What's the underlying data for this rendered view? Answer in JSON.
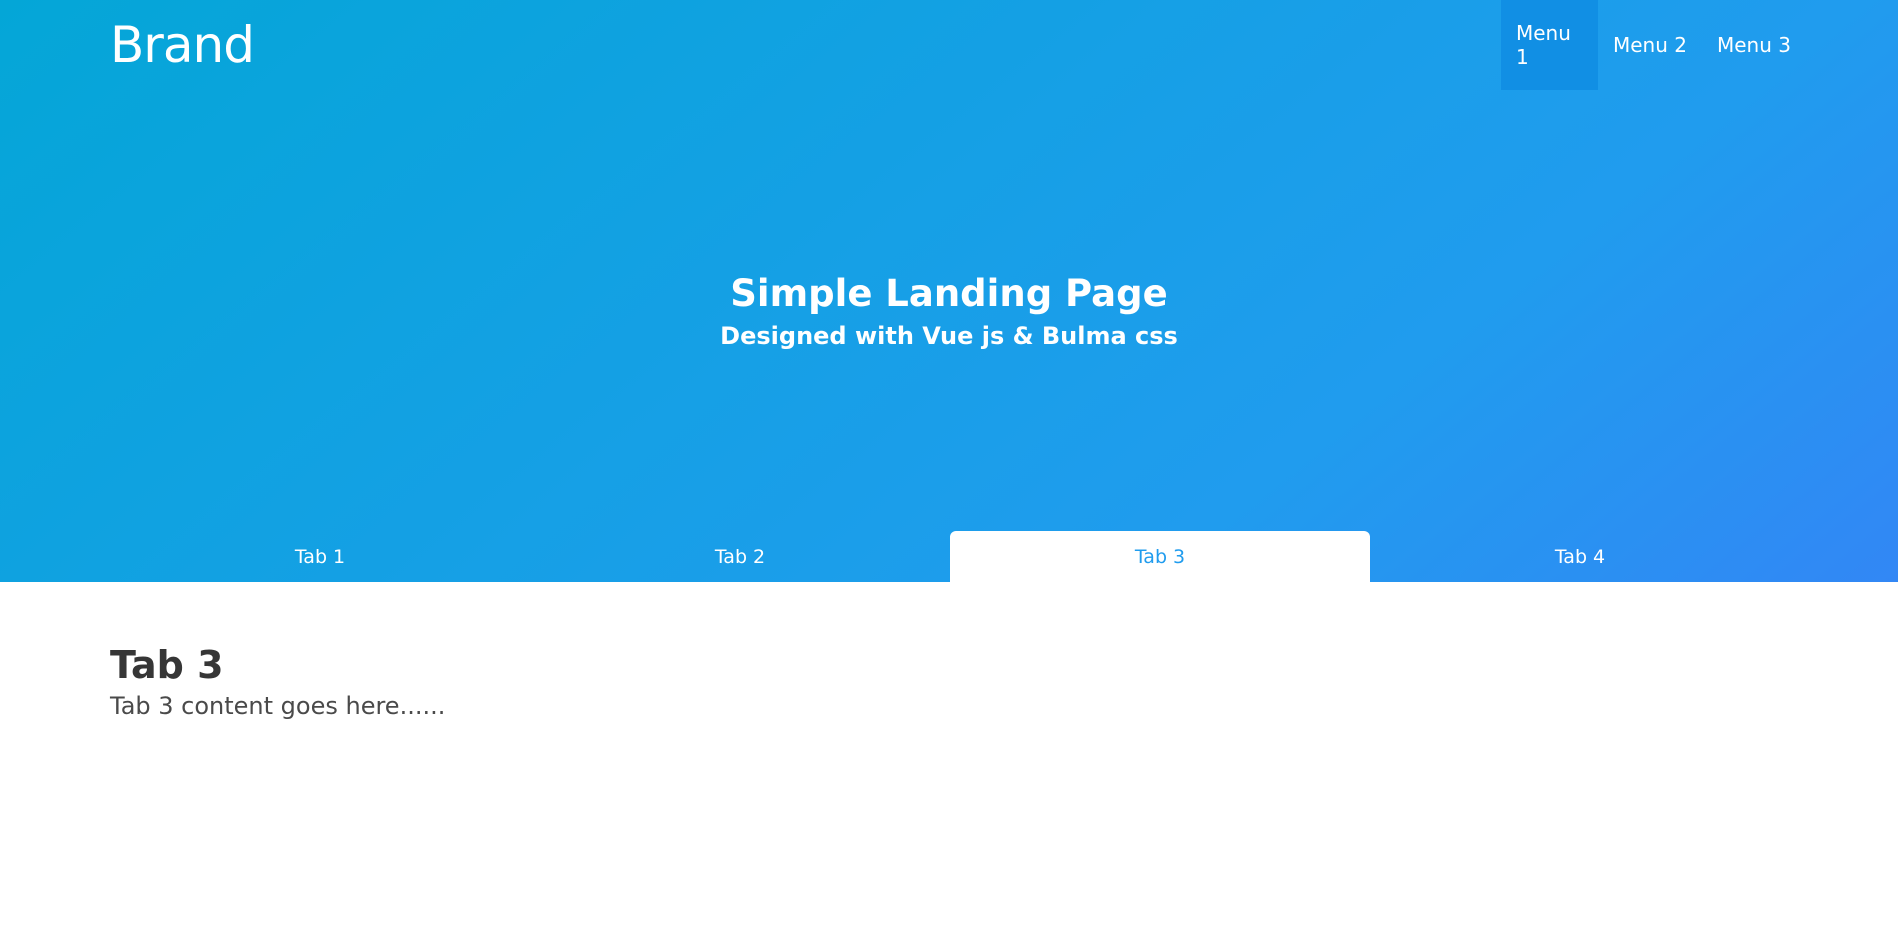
{
  "navbar": {
    "brand": "Brand",
    "menu": [
      {
        "label": "Menu 1",
        "active": true
      },
      {
        "label": "Menu 2",
        "active": false
      },
      {
        "label": "Menu 3",
        "active": false
      }
    ]
  },
  "hero": {
    "title": "Simple Landing Page",
    "subtitle": "Designed with Vue js & Bulma css"
  },
  "tabs": [
    {
      "label": "Tab 1",
      "active": false
    },
    {
      "label": "Tab 2",
      "active": false
    },
    {
      "label": "Tab 3",
      "active": true
    },
    {
      "label": "Tab 4",
      "active": false
    }
  ],
  "content": {
    "title": "Tab 3",
    "text": "Tab 3 content goes here......"
  },
  "colors": {
    "gradient_start": "#04a6d7",
    "gradient_mid": "#209cee",
    "gradient_end": "#3287f5",
    "active_menu_bg": "#118fe4",
    "active_tab_text": "#209cee"
  }
}
